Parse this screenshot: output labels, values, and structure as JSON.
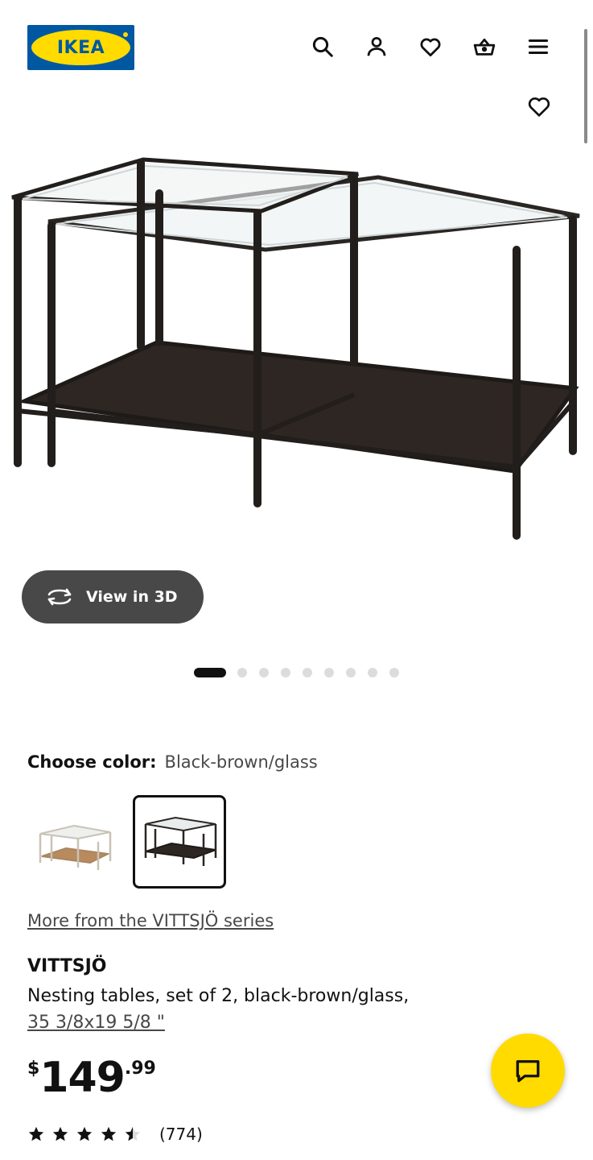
{
  "header": {
    "logo_text": "IKEA",
    "icons": [
      "search-icon",
      "user-icon",
      "heart-icon",
      "basket-icon",
      "menu-icon"
    ]
  },
  "gallery": {
    "view_3d_label": "View in 3D",
    "total_images": 9,
    "active_image": 1
  },
  "color_picker": {
    "label": "Choose color:",
    "selected_value": "Black-brown/glass",
    "options": [
      "white-stained oak effect/glass",
      "black-brown/glass"
    ]
  },
  "product": {
    "series_link": "More from the VITTSJÖ series",
    "name": "VITTSJÖ",
    "description": "Nesting tables, set of 2, black-brown/glass,",
    "dimensions": "35 3/8x19 5/8 \"",
    "price": {
      "currency": "$",
      "integer": "149",
      "decimal": ".99"
    },
    "rating": {
      "stars": 4.5,
      "count": "(774)"
    }
  },
  "colors": {
    "ikea_blue": "#0058a3",
    "ikea_yellow": "#ffdb00",
    "dark_gray": "#484848"
  }
}
